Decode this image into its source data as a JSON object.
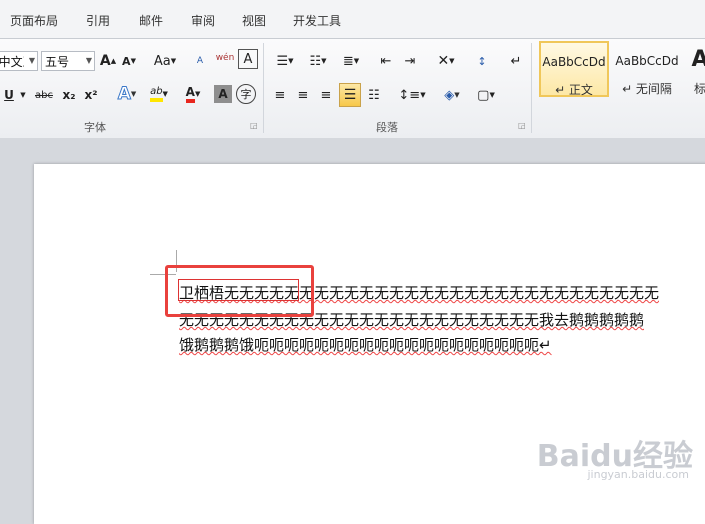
{
  "tabs": [
    "页面布局",
    "引用",
    "邮件",
    "审阅",
    "视图",
    "开发工具"
  ],
  "font": {
    "name_value": "(中文正文",
    "size_value": "五号",
    "group_label": "字体"
  },
  "paragraph": {
    "group_label": "段落"
  },
  "styles": [
    {
      "sample": "AaBbCcDd",
      "name": "↵ 正文"
    },
    {
      "sample": "AaBbCcDd",
      "name": "↵ 无间隔"
    },
    {
      "sample": "A",
      "name": "标"
    }
  ],
  "toolbar_glyphs": {
    "grow": "A",
    "shrink": "A",
    "case": "Aa",
    "bold_u": "U",
    "strike": "abc",
    "sub": "x₂",
    "sup": "x²",
    "text_effect": "A",
    "highlight": "ab",
    "font_color": "A",
    "char_shade": "A",
    "enclose": "字",
    "pinyin": "wén",
    "border_char": "A",
    "clear": "A"
  },
  "document": {
    "line1": "卫栖梧无无无无无无无无无无无无无无无无无无无无无无无无无无无无无",
    "line2": "无无无无无无无无无无无无无无无无无无无无无无无无我去鹅鹅鹅鹅鹅",
    "line3": "饿鹅鹅鹅饿呃呃呃呃呃呃呃呃呃呃呃呃呃呃呃呃呃呃呃↵"
  },
  "watermark": {
    "brand": "Baidu经验",
    "url": "jingyan.baidu.com"
  }
}
